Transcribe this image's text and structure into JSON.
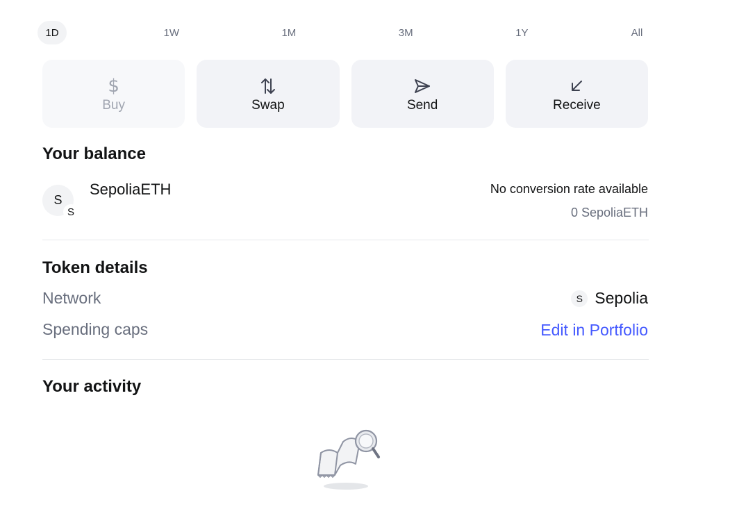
{
  "time_ranges": [
    {
      "label": "1D",
      "active": true
    },
    {
      "label": "1W",
      "active": false
    },
    {
      "label": "1M",
      "active": false
    },
    {
      "label": "3M",
      "active": false
    },
    {
      "label": "1Y",
      "active": false
    },
    {
      "label": "All",
      "active": false
    }
  ],
  "actions": {
    "buy": {
      "label": "Buy",
      "icon": "dollar-icon",
      "disabled": true
    },
    "swap": {
      "label": "Swap",
      "icon": "swap-arrows-icon"
    },
    "send": {
      "label": "Send",
      "icon": "send-arrow-icon"
    },
    "receive": {
      "label": "Receive",
      "icon": "receive-arrow-icon"
    }
  },
  "balance": {
    "heading": "Your balance",
    "avatar_letter": "S",
    "badge_letter": "S",
    "token_name": "SepoliaETH",
    "conversion_text": "No conversion rate available",
    "amount": "0 SepoliaETH"
  },
  "token_details": {
    "heading": "Token details",
    "network_label": "Network",
    "network_avatar_letter": "S",
    "network_name": "Sepolia",
    "spending_caps_label": "Spending caps",
    "spending_caps_link": "Edit in Portfolio"
  },
  "activity": {
    "heading": "Your activity",
    "empty_icon": "empty-activity-illustration"
  },
  "colors": {
    "link": "#4459ff",
    "muted_text": "#686e7d",
    "button_bg": "#f2f3f7",
    "divider": "#e6e8eb"
  }
}
